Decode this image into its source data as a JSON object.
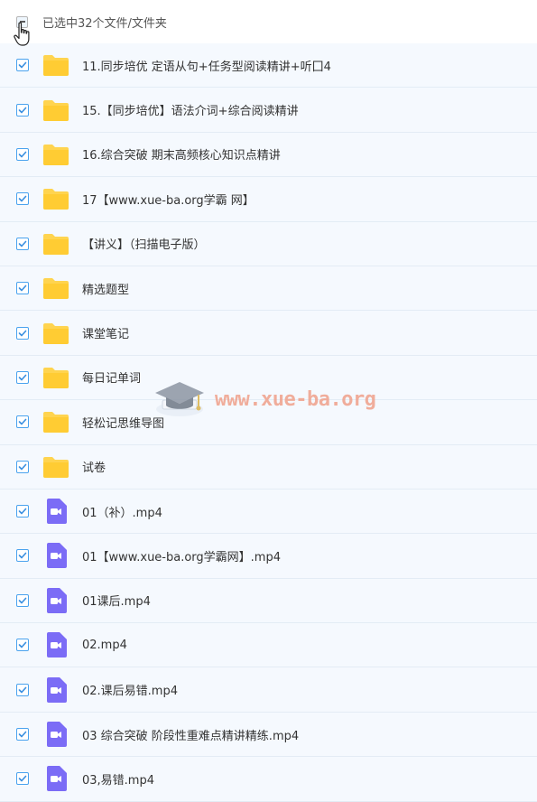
{
  "header": {
    "selection_label": "已选中32个文件/文件夹"
  },
  "files": [
    {
      "name": "11.同步培优 定语从句+任务型阅读精讲+听囗4",
      "type": "folder"
    },
    {
      "name": "15.【同步培优】语法介词+综合阅读精讲",
      "type": "folder"
    },
    {
      "name": "16.综合突破 期末高频核心知识点精讲",
      "type": "folder"
    },
    {
      "name": "17【www.xue-ba.org学霸 网】",
      "type": "folder"
    },
    {
      "name": "【讲义】（扫描电子版）",
      "type": "folder"
    },
    {
      "name": "精选题型",
      "type": "folder"
    },
    {
      "name": "课堂笔记",
      "type": "folder"
    },
    {
      "name": "每日记单词",
      "type": "folder"
    },
    {
      "name": "轻松记思维导图",
      "type": "folder"
    },
    {
      "name": "试卷",
      "type": "folder"
    },
    {
      "name": "01（补）.mp4",
      "type": "video"
    },
    {
      "name": "01【www.xue-ba.org学霸网】.mp4",
      "type": "video"
    },
    {
      "name": "01课后.mp4",
      "type": "video"
    },
    {
      "name": "02.mp4",
      "type": "video"
    },
    {
      "name": "02.课后易错.mp4",
      "type": "video"
    },
    {
      "name": "03 综合突破 阶段性重难点精讲精练.mp4",
      "type": "video"
    },
    {
      "name": "03,易错.mp4",
      "type": "video"
    }
  ],
  "watermark": {
    "text": "www.xue-ba.org"
  },
  "colors": {
    "checkbox_accent": "#4ba3ee",
    "folder": "#ffd44f",
    "video": "#7b6cf6",
    "row_bg": "#f5f9fe",
    "watermark": "#f0a08a"
  }
}
